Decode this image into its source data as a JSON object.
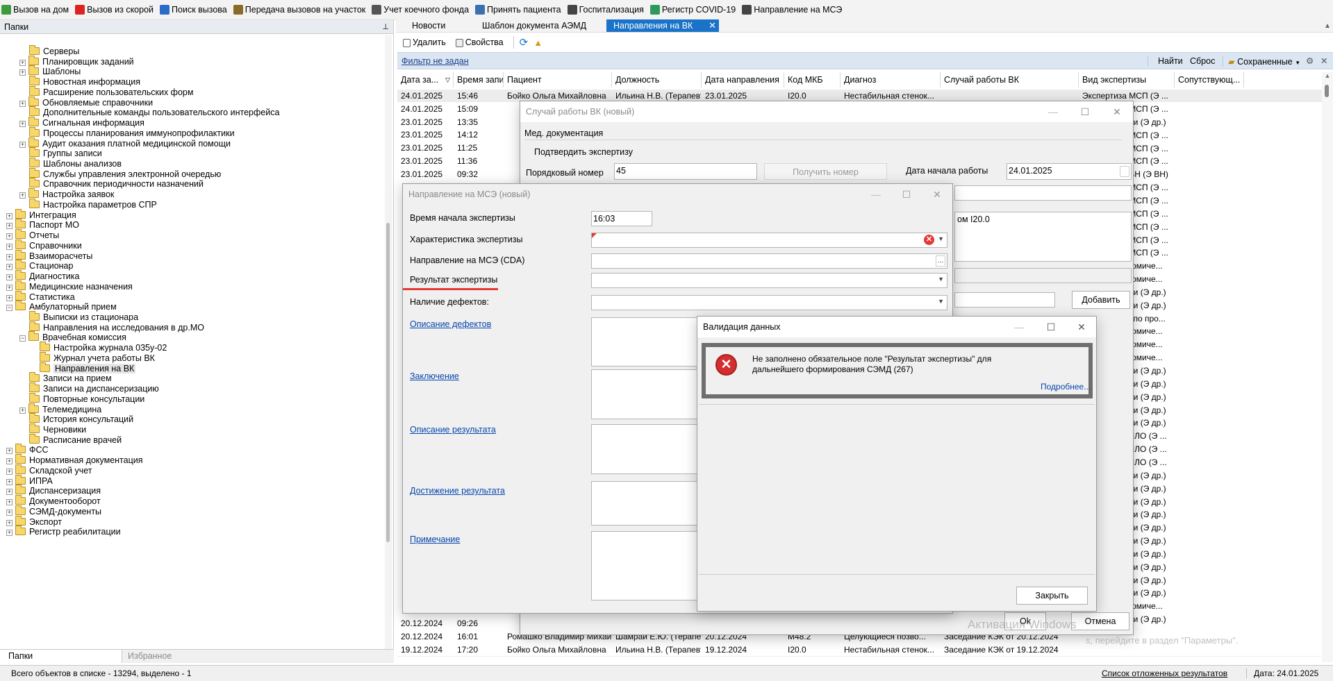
{
  "toolbar": {
    "items": [
      "Вызов на дом",
      "Вызов из скорой",
      "Поиск вызова",
      "Передача вызовов на участок",
      "Учет коечного фонда",
      "Принять пациента",
      "Госпитализация",
      "Регистр COVID-19",
      "Направление на МСЭ"
    ],
    "icon_colors": [
      "#3d9a3d",
      "#d22",
      "#2a6cc8",
      "#8a6a2a",
      "#555",
      "#3a6fb0",
      "#444",
      "#2e9a5a",
      "#444"
    ]
  },
  "left_panel": {
    "title": "Папки",
    "pin": "⊥",
    "tree": [
      {
        "label": "Серверы",
        "level": 2,
        "exp": false
      },
      {
        "label": "Планировщик заданий",
        "level": 2,
        "exp": true
      },
      {
        "label": "Шаблоны",
        "level": 2,
        "exp": true
      },
      {
        "label": "Новостная информация",
        "level": 2,
        "exp": false
      },
      {
        "label": "Расширение пользовательских форм",
        "level": 2,
        "exp": false
      },
      {
        "label": "Обновляемые справочники",
        "level": 2,
        "exp": true
      },
      {
        "label": "Дополнительные команды пользовательского интерфейса",
        "level": 2,
        "exp": false
      },
      {
        "label": "Сигнальная информация",
        "level": 2,
        "exp": true
      },
      {
        "label": "Процессы планирования иммунопрофилактики",
        "level": 2,
        "exp": false
      },
      {
        "label": "Аудит оказания платной медицинской помощи",
        "level": 2,
        "exp": true
      },
      {
        "label": "Группы записи",
        "level": 2,
        "exp": false
      },
      {
        "label": "Шаблоны анализов",
        "level": 2,
        "exp": false
      },
      {
        "label": "Службы управления электронной очередью",
        "level": 2,
        "exp": false
      },
      {
        "label": "Справочник периодичности назначений",
        "level": 2,
        "exp": false
      },
      {
        "label": "Настройка заявок",
        "level": 2,
        "exp": true
      },
      {
        "label": "Настройка параметров СПР",
        "level": 2,
        "exp": false
      },
      {
        "label": "Интеграция",
        "level": 1,
        "exp": true
      },
      {
        "label": "Паспорт МО",
        "level": 1,
        "exp": true
      },
      {
        "label": "Отчеты",
        "level": 1,
        "exp": true
      },
      {
        "label": "Справочники",
        "level": 1,
        "exp": true
      },
      {
        "label": "Взаиморасчеты",
        "level": 1,
        "exp": true
      },
      {
        "label": "Стационар",
        "level": 1,
        "exp": true
      },
      {
        "label": "Диагностика",
        "level": 1,
        "exp": true
      },
      {
        "label": "Медицинские назначения",
        "level": 1,
        "exp": true
      },
      {
        "label": "Статистика",
        "level": 1,
        "exp": true
      },
      {
        "label": "Амбулаторный прием",
        "level": 1,
        "exp": true,
        "open": true
      },
      {
        "label": "Выписки из стационара",
        "level": 2,
        "exp": false
      },
      {
        "label": "Направления на исследования в др.МО",
        "level": 2,
        "exp": false
      },
      {
        "label": "Врачебная комиссия",
        "level": 2,
        "exp": true,
        "open": true
      },
      {
        "label": "Настройка журнала 035у-02",
        "level": 3,
        "exp": false
      },
      {
        "label": "Журнал учета работы ВК",
        "level": 3,
        "exp": false
      },
      {
        "label": "Направления на ВК",
        "level": 3,
        "exp": false,
        "selected": true
      },
      {
        "label": "Записи на прием",
        "level": 2,
        "exp": false
      },
      {
        "label": "Записи на диспансеризацию",
        "level": 2,
        "exp": false
      },
      {
        "label": "Повторные консультации",
        "level": 2,
        "exp": false
      },
      {
        "label": "Телемедицина",
        "level": 2,
        "exp": true
      },
      {
        "label": "История консультаций",
        "level": 2,
        "exp": false
      },
      {
        "label": "Черновики",
        "level": 2,
        "exp": false
      },
      {
        "label": "Расписание врачей",
        "level": 2,
        "exp": false
      },
      {
        "label": "ФСС",
        "level": 1,
        "exp": true
      },
      {
        "label": "Нормативная документация",
        "level": 1,
        "exp": true
      },
      {
        "label": "Складской учет",
        "level": 1,
        "exp": true
      },
      {
        "label": "ИПРА",
        "level": 1,
        "exp": true
      },
      {
        "label": "Диспансеризация",
        "level": 1,
        "exp": true
      },
      {
        "label": "Документооборот",
        "level": 1,
        "exp": true
      },
      {
        "label": "СЭМД-документы",
        "level": 1,
        "exp": true
      },
      {
        "label": "Экспорт",
        "level": 1,
        "exp": true
      },
      {
        "label": "Регистр реабилитации",
        "level": 1,
        "exp": true
      }
    ],
    "tabs": [
      "Папки",
      "Избранное"
    ]
  },
  "doc_tabs": [
    "Новости",
    "Шаблон документа АЭМД",
    "Направления на ВК"
  ],
  "grid_toolbar": {
    "delete": "Удалить",
    "properties": "Свойства"
  },
  "filter": {
    "text": "Фильтр не задан",
    "find": "Найти",
    "reset": "Сброс",
    "saved": "Сохраненные"
  },
  "grid": {
    "headers": [
      "Дата за...",
      "Время записи",
      "Пациент",
      "Должность",
      "Дата направления",
      "Код МКБ",
      "Диагноз",
      "Случай работы ВК",
      "Вид экспертизы",
      "Сопутствующ..."
    ],
    "top_rows": [
      [
        "24.01.2025",
        "15:46",
        "Бойко Ольга Михайловна",
        "Ильина Н.В. (Терапевт ...",
        "23.01.2025",
        "I20.0",
        "Нестабильная стенок...",
        "",
        "Экспертиза МСП (Э ..."
      ],
      [
        "24.01.2025",
        "15:09"
      ],
      [
        "23.01.2025",
        "13:35"
      ],
      [
        "23.01.2025",
        "14:12"
      ],
      [
        "23.01.2025",
        "11:25"
      ],
      [
        "23.01.2025",
        "11:36"
      ],
      [
        "23.01.2025",
        "09:32"
      ]
    ],
    "right_col": [
      "Экспертиза МСП (Э ...",
      "Другие случаи (Э др.)",
      "Экспертиза МСП (Э ...",
      "Экспертиза МСП (Э ...",
      "Экспертиза МСП (Э ...",
      "Экспертиза ВН (Э ВН)",
      "Экспертиза МСП (Э ...",
      "Экспертиза МСП (Э ...",
      "Экспертиза МСП (Э ...",
      "Экспертиза МСП (Э ...",
      "Экспертиза МСП (Э ...",
      "Экспертиза МСП (Э ...",
      "Медико-экономиче...",
      "Медико-экономиче...",
      "Другие случаи (Э др.)",
      "Другие случаи (Э др.)",
      "ВК по МСПР по про...",
      "Медико-экономиче...",
      "Медико-экономиче...",
      "Медико-экономиче...",
      "Другие случаи (Э др.)",
      "Другие случаи (Э др.)",
      "Другие случаи (Э др.)",
      "Другие случаи (Э др.)",
      "Другие случаи (Э др.)",
      "Экспертиза ЛЛО (Э ...",
      "Экспертиза ЛЛО (Э ...",
      "Экспертиза ЛЛО (Э ...",
      "Другие случаи (Э др.)",
      "Другие случаи (Э др.)",
      "Другие случаи (Э др.)",
      "Другие случаи (Э др.)",
      "Другие случаи (Э др.)",
      "Другие случаи (Э др.)",
      "Другие случаи (Э др.)",
      "Другие случаи (Э др.)",
      "Другие случаи (Э др.)",
      "Другие случаи (Э др.)",
      "Медико-экономиче...",
      "Другие случаи (Э др.)",
      "Медико-экономиче..."
    ],
    "bottom_rows": [
      [
        "20.12.2024",
        "09:26",
        "",
        "",
        "",
        "",
        "",
        ""
      ],
      [
        "20.12.2024",
        "16:01",
        "Ромашко Владимир Михайло...",
        "Шамрай Е.Ю. (Терапевт)",
        "20.12.2024",
        "M48.2",
        "Целующиеся позво...",
        "Заседание КЭК от 20.12.2024"
      ],
      [
        "19.12.2024",
        "17:20",
        "Бойко Ольга Михайловна",
        "Ильина Н.В. (Терапевт ...",
        "19.12.2024",
        "I20.0",
        "Нестабильная стенок...",
        "Заседание КЭК от 19.12.2024"
      ]
    ]
  },
  "vk_window": {
    "title": "Случай работы ВК (новый)",
    "tab": "Мед. документация",
    "confirm": "Подтвердить экспертизу",
    "order_label": "Порядковый номер",
    "order_value": "45",
    "get_number": "Получить номер",
    "start_date_label": "Дата начала работы",
    "start_date_value": "24.01.2025",
    "diag_text": "ом I20.0",
    "add": "Добавить",
    "ok": "Ok",
    "cancel": "Отмена"
  },
  "mse_window": {
    "title": "Направление на МСЭ (новый)",
    "labels": [
      "Время начала экспертизы",
      "Характеристика экспертизы",
      "Направление на МСЭ (CDA)",
      "Результат экспертизы",
      "Наличие дефектов:"
    ],
    "time_value": "16:03",
    "links": [
      "Описание дефектов",
      "Заключение",
      "Описание результата",
      "Достижение результата",
      "Примечание"
    ]
  },
  "validation": {
    "title": "Валидация данных",
    "message": "Не заполнено обязательное поле  \"Результат экспертизы\" для дальнейшего формирования СЭМД (267)",
    "more": "Подробнее...",
    "close": "Закрыть"
  },
  "watermark": {
    "title": "Активация Windows",
    "sub": "s, перейдите в раздел \"Параметры\"."
  },
  "status": {
    "count": "Всего объектов в списке - 13294, выделено - 1",
    "deferred": "Список отложенных результатов",
    "date": "Дата: 24.01.2025"
  },
  "colors": {
    "accent": "#1a73c8",
    "error": "#d32f2f",
    "underline": "#e53935"
  }
}
